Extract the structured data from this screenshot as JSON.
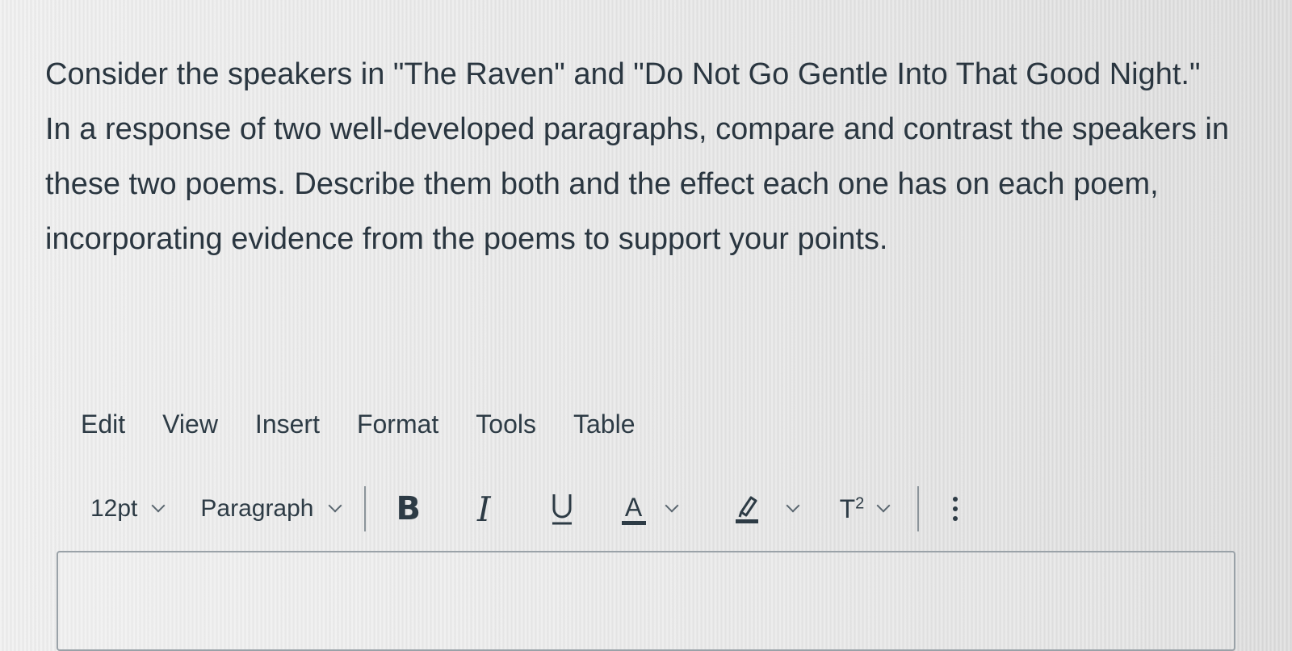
{
  "prompt": {
    "line1": "Consider the speakers in \"The Raven\" and \"Do Not Go Gentle Into That Good Night.\"",
    "line2": "In a response of two well-developed paragraphs, compare and contrast the speakers in these two poems. Describe them both and the effect each one has on each poem, incorporating evidence from the poems to support your points."
  },
  "menubar": {
    "items": [
      "Edit",
      "View",
      "Insert",
      "Format",
      "Tools",
      "Table"
    ]
  },
  "toolbar": {
    "font_size": "12pt",
    "block_format": "Paragraph",
    "bold_label": "B",
    "italic_label": "I",
    "underline_label": "U",
    "text_color_label": "A",
    "superscript_base": "T",
    "superscript_exp": "2",
    "icons": {
      "bold": "bold-icon",
      "italic": "italic-icon",
      "underline": "underline-icon",
      "text_color": "text-color-icon",
      "highlight": "highlighter-icon",
      "superscript": "superscript-icon",
      "more": "more-vertical-icon"
    }
  },
  "colors": {
    "text": "#2d3b45",
    "background": "#e9e9e9"
  }
}
